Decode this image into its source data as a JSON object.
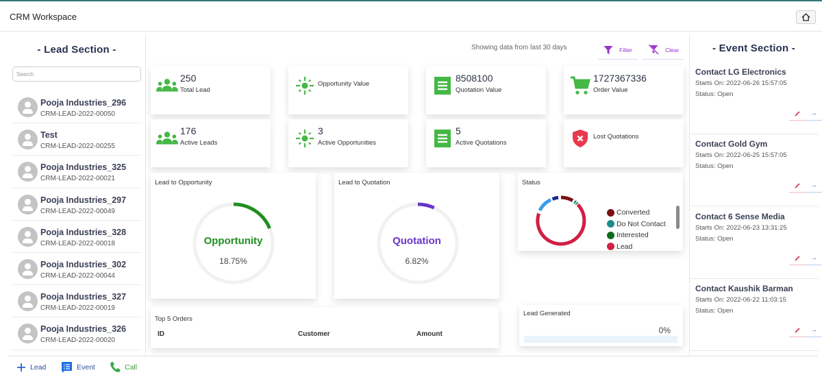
{
  "header": {
    "title": "CRM Workspace",
    "home_icon": "home-icon"
  },
  "lead_section": {
    "title": "- Lead Section -",
    "search_placeholder": "Search",
    "leads": [
      {
        "name": "Pooja Industries_296",
        "code": "CRM-LEAD-2022-00050"
      },
      {
        "name": "Test",
        "code": "CRM-LEAD-2022-00255"
      },
      {
        "name": "Pooja Industries_325",
        "code": "CRM-LEAD-2022-00021"
      },
      {
        "name": "Pooja Industries_297",
        "code": "CRM-LEAD-2022-00049"
      },
      {
        "name": "Pooja Industries_328",
        "code": "CRM-LEAD-2022-00018"
      },
      {
        "name": "Pooja Industries_302",
        "code": "CRM-LEAD-2022-00044"
      },
      {
        "name": "Pooja Industries_327",
        "code": "CRM-LEAD-2022-00019"
      },
      {
        "name": "Pooja Industries_326",
        "code": "CRM-LEAD-2022-00020"
      }
    ]
  },
  "bottom_bar": {
    "lead_label": "Lead",
    "event_label": "Event",
    "call_label": "Call"
  },
  "dashboard": {
    "showing_text": "Showing data from last 30 days",
    "filter_label": "Filter",
    "clear_label": "Clear",
    "stats": [
      {
        "value": "250",
        "label": "Total Lead",
        "icon": "users-icon"
      },
      {
        "value": "",
        "label": "Opportunity Value",
        "icon": "sun-icon"
      },
      {
        "value": "8508100",
        "label": "Quotation Value",
        "icon": "receipt-icon"
      },
      {
        "value": "1727367336",
        "label": "Order Value",
        "icon": "cart-icon"
      },
      {
        "value": "176",
        "label": "Active Leads",
        "icon": "users-icon"
      },
      {
        "value": "3",
        "label": "Active Opportunities",
        "icon": "sun-icon"
      },
      {
        "value": "5",
        "label": "Active Quotations",
        "icon": "receipt-icon"
      },
      {
        "value": "",
        "label": "Lost Quotations",
        "icon": "shield-x-icon"
      }
    ],
    "lead_to_opportunity": {
      "title": "Lead to Opportunity",
      "label": "Opportunity",
      "percent_text": "18.75%",
      "percent": 18.75,
      "color": "#1f8f1f"
    },
    "lead_to_quotation": {
      "title": "Lead to Quotation",
      "label": "Quotation",
      "percent_text": "6.82%",
      "percent": 6.82,
      "color": "#6a35c9"
    },
    "status": {
      "title": "Status",
      "legend": [
        {
          "label": "Converted",
          "color": "#7a0f14"
        },
        {
          "label": "Do Not Contact",
          "color": "#1f8a8a"
        },
        {
          "label": "Interested",
          "color": "#0d6b1a"
        },
        {
          "label": "Lead",
          "color": "#d21f44"
        }
      ]
    },
    "top_orders": {
      "title": "Top 5 Orders",
      "columns": [
        "ID",
        "Customer",
        "Amount"
      ]
    },
    "lead_generated": {
      "title": "Lead Generated",
      "percent_text": "0%",
      "percent": 0
    }
  },
  "event_section": {
    "title": "- Event Section -",
    "events": [
      {
        "name": "Contact LG Electronics",
        "starts": "Starts On: 2022-06-26 15:57:05",
        "status": "Status: Open"
      },
      {
        "name": "Contact Gold Gym",
        "starts": "Starts On: 2022-06-25 15:57:05",
        "status": "Status: Open"
      },
      {
        "name": "Contact 6 Sense Media",
        "starts": "Starts On: 2022-06-23 13:31:25",
        "status": "Status: Open"
      },
      {
        "name": "Contact Kaushik Barman",
        "starts": "Starts On: 2022-06-22 11:03:15",
        "status": "Status: Open"
      }
    ],
    "edit_icon": "pencil-icon",
    "open_icon": "arrow-right-icon"
  }
}
